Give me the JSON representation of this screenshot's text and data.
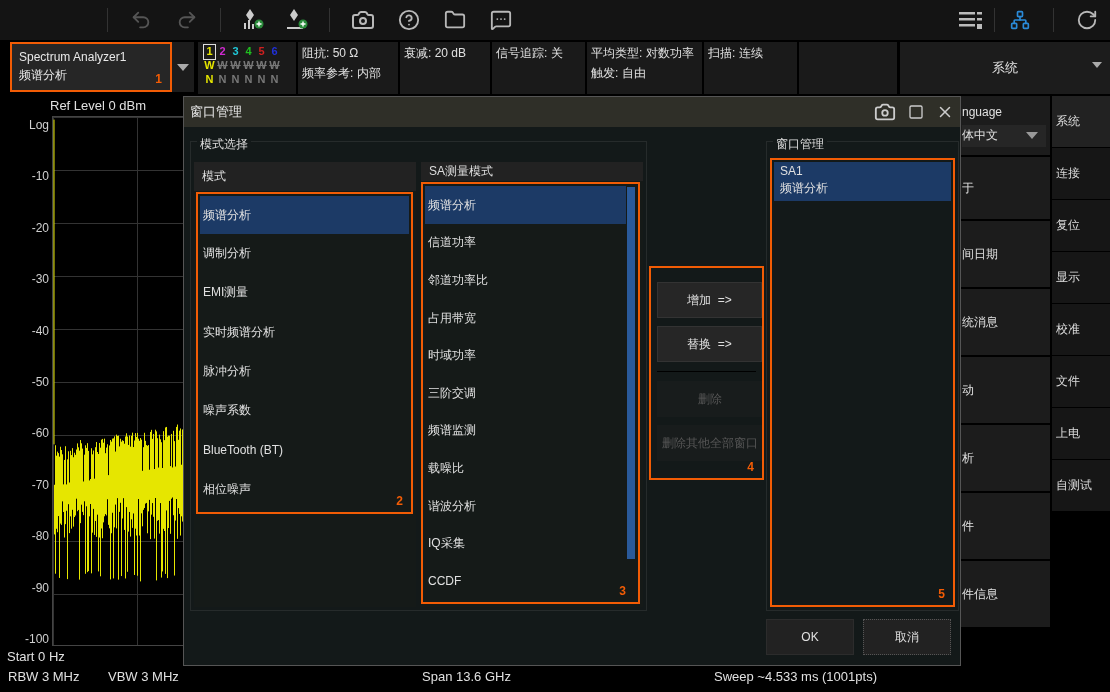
{
  "mode_selector": {
    "name": "Spectrum Analyzer1",
    "mode": "频谱分析",
    "callout": "1"
  },
  "traces": [
    {
      "number": "1",
      "color": "#e6e600",
      "selected": true,
      "type": "W",
      "detector": "N",
      "on": true
    },
    {
      "number": "2",
      "color": "#d02ad0",
      "selected": false,
      "type": "W",
      "detector": "N",
      "on": false
    },
    {
      "number": "3",
      "color": "#20c8d8",
      "selected": false,
      "type": "W",
      "detector": "N",
      "on": false
    },
    {
      "number": "4",
      "color": "#20c020",
      "selected": false,
      "type": "W",
      "detector": "N",
      "on": false
    },
    {
      "number": "5",
      "color": "#d02020",
      "selected": false,
      "type": "W",
      "detector": "N",
      "on": false
    },
    {
      "number": "6",
      "color": "#2030d8",
      "selected": false,
      "type": "W",
      "detector": "N",
      "on": false
    }
  ],
  "status_cells": [
    {
      "lines": [
        "阻抗: 50 Ω",
        "频率参考: 内部"
      ]
    },
    {
      "lines": [
        "衰减: 20 dB"
      ]
    },
    {
      "lines": [
        "信号追踪: 关"
      ]
    },
    {
      "lines": [
        "平均类型: 对数功率",
        "触发: 自由"
      ]
    },
    {
      "lines": [
        "扫描: 连续"
      ]
    }
  ],
  "menu_header": "系统",
  "graph": {
    "ref_level": "Ref Level  0 dBm",
    "scale": "Log",
    "y_labels": [
      "-10",
      "-20",
      "-30",
      "-40",
      "-50",
      "-60",
      "-70",
      "-80",
      "-90",
      "-100"
    ],
    "start": "Start  0 Hz",
    "rbw": "RBW  3 MHz",
    "vbw": "VBW  3 MHz",
    "span": "Span  13.6 GHz",
    "sweep": "Sweep  ~4.533 ms (1001pts)"
  },
  "system_menu": [
    {
      "kind": "dropdown",
      "label": "nguage",
      "value": "体中文"
    },
    {
      "kind": "button",
      "label": "于"
    },
    {
      "kind": "button",
      "label": "间日期"
    },
    {
      "kind": "button",
      "label": "统消息"
    },
    {
      "kind": "button",
      "label": "动"
    },
    {
      "kind": "button",
      "label": "析"
    },
    {
      "kind": "button",
      "label": "件"
    },
    {
      "kind": "button",
      "label": "件信息"
    }
  ],
  "side_tabs": [
    {
      "label": "系统",
      "selected": true
    },
    {
      "label": "连接",
      "selected": false
    },
    {
      "label": "复位",
      "selected": false
    },
    {
      "label": "显示",
      "selected": false
    },
    {
      "label": "校准",
      "selected": false
    },
    {
      "label": "文件",
      "selected": false
    },
    {
      "label": "上电",
      "selected": false
    },
    {
      "label": "自测试",
      "selected": false
    }
  ],
  "dialog": {
    "title": "窗口管理",
    "mode_group": {
      "title": "模式选择",
      "mode_list": {
        "header": "模式",
        "callout": "2",
        "items": [
          {
            "label": "频谱分析",
            "selected": true
          },
          {
            "label": "调制分析",
            "selected": false
          },
          {
            "label": "EMI测量",
            "selected": false
          },
          {
            "label": "实时频谱分析",
            "selected": false
          },
          {
            "label": "脉冲分析",
            "selected": false
          },
          {
            "label": "噪声系数",
            "selected": false
          },
          {
            "label": "BlueTooth (BT)",
            "selected": false
          },
          {
            "label": "相位噪声",
            "selected": false
          }
        ]
      },
      "measure_list": {
        "header": "SA测量模式",
        "callout": "3",
        "items": [
          {
            "label": "频谱分析",
            "selected": true
          },
          {
            "label": "信道功率",
            "selected": false
          },
          {
            "label": "邻道功率比",
            "selected": false
          },
          {
            "label": "占用带宽",
            "selected": false
          },
          {
            "label": "时域功率",
            "selected": false
          },
          {
            "label": "三阶交调",
            "selected": false
          },
          {
            "label": "频谱监测",
            "selected": false
          },
          {
            "label": "载噪比",
            "selected": false
          },
          {
            "label": "谐波分析",
            "selected": false
          },
          {
            "label": "IQ采集",
            "selected": false
          },
          {
            "label": "CCDF",
            "selected": false
          }
        ]
      }
    },
    "actions": {
      "callout": "4",
      "buttons": [
        {
          "label": "增加  =>",
          "disabled": false
        },
        {
          "label": "替换  =>",
          "disabled": false
        },
        {
          "label": "删除",
          "disabled": true
        },
        {
          "label": "删除其他全部窗口",
          "disabled": true
        }
      ]
    },
    "window_group": {
      "title": "窗口管理",
      "callout": "5",
      "windows": [
        {
          "name": "SA1",
          "mode": "频谱分析",
          "selected": true
        }
      ]
    },
    "ok": "OK",
    "cancel": "取消"
  }
}
